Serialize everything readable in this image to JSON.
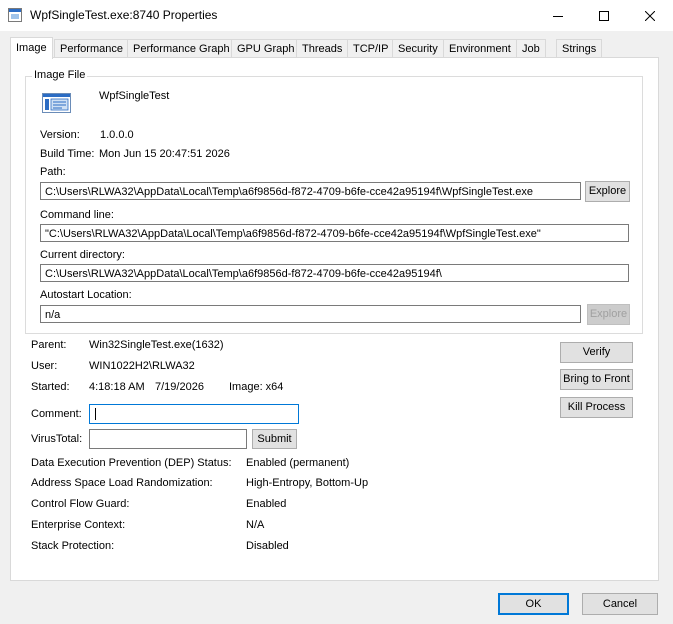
{
  "window": {
    "title": "WpfSingleTest.exe:8740 Properties",
    "minimize_icon": "minimize-icon",
    "maximize_icon": "maximize-icon",
    "close_icon": "close-icon"
  },
  "tabs": [
    {
      "label": "Image",
      "active": true
    },
    {
      "label": "Performance"
    },
    {
      "label": "Performance Graph"
    },
    {
      "label": "GPU Graph"
    },
    {
      "label": "Threads"
    },
    {
      "label": "TCP/IP"
    },
    {
      "label": "Security"
    },
    {
      "label": "Environment"
    },
    {
      "label": "Job"
    },
    {
      "label": "Strings"
    }
  ],
  "image_file": {
    "group_label": "Image File",
    "icon": "application-window-icon",
    "name": "WpfSingleTest",
    "version_label": "Version:",
    "version": "1.0.0.0",
    "build_time_label": "Build Time:",
    "build_time": "Mon Jun 15 20:47:51 2026",
    "path_label": "Path:",
    "path": "C:\\Users\\RLWA32\\AppData\\Local\\Temp\\a6f9856d-f872-4709-b6fe-cce42a95194f\\WpfSingleTest.exe",
    "explore_label": "Explore",
    "command_line_label": "Command line:",
    "command_line": "\"C:\\Users\\RLWA32\\AppData\\Local\\Temp\\a6f9856d-f872-4709-b6fe-cce42a95194f\\WpfSingleTest.exe\"",
    "current_directory_label": "Current directory:",
    "current_directory": "C:\\Users\\RLWA32\\AppData\\Local\\Temp\\a6f9856d-f872-4709-b6fe-cce42a95194f\\",
    "autostart_label": "Autostart Location:",
    "autostart": "n/a",
    "autostart_explore_label": "Explore"
  },
  "process": {
    "parent_label": "Parent:",
    "parent": "Win32SingleTest.exe(1632)",
    "user_label": "User:",
    "user": "WIN1022H2\\RLWA32",
    "started_label": "Started:",
    "started_time": "4:18:18 AM",
    "started_date": "7/19/2026",
    "image_arch": "Image: x64",
    "verify_label": "Verify",
    "bring_to_front_label": "Bring to Front",
    "kill_process_label": "Kill Process",
    "comment_label": "Comment:",
    "comment_value": "",
    "virustotal_label": "VirusTotal:",
    "virustotal_value": "",
    "submit_label": "Submit"
  },
  "mitigations": [
    {
      "label": "Data Execution Prevention (DEP) Status:",
      "value": "Enabled (permanent)"
    },
    {
      "label": "Address Space Load Randomization:",
      "value": "High-Entropy, Bottom-Up"
    },
    {
      "label": "Control Flow Guard:",
      "value": "Enabled"
    },
    {
      "label": "Enterprise Context:",
      "value": "N/A"
    },
    {
      "label": "Stack Protection:",
      "value": "Disabled"
    }
  ],
  "footer": {
    "ok_label": "OK",
    "cancel_label": "Cancel"
  }
}
